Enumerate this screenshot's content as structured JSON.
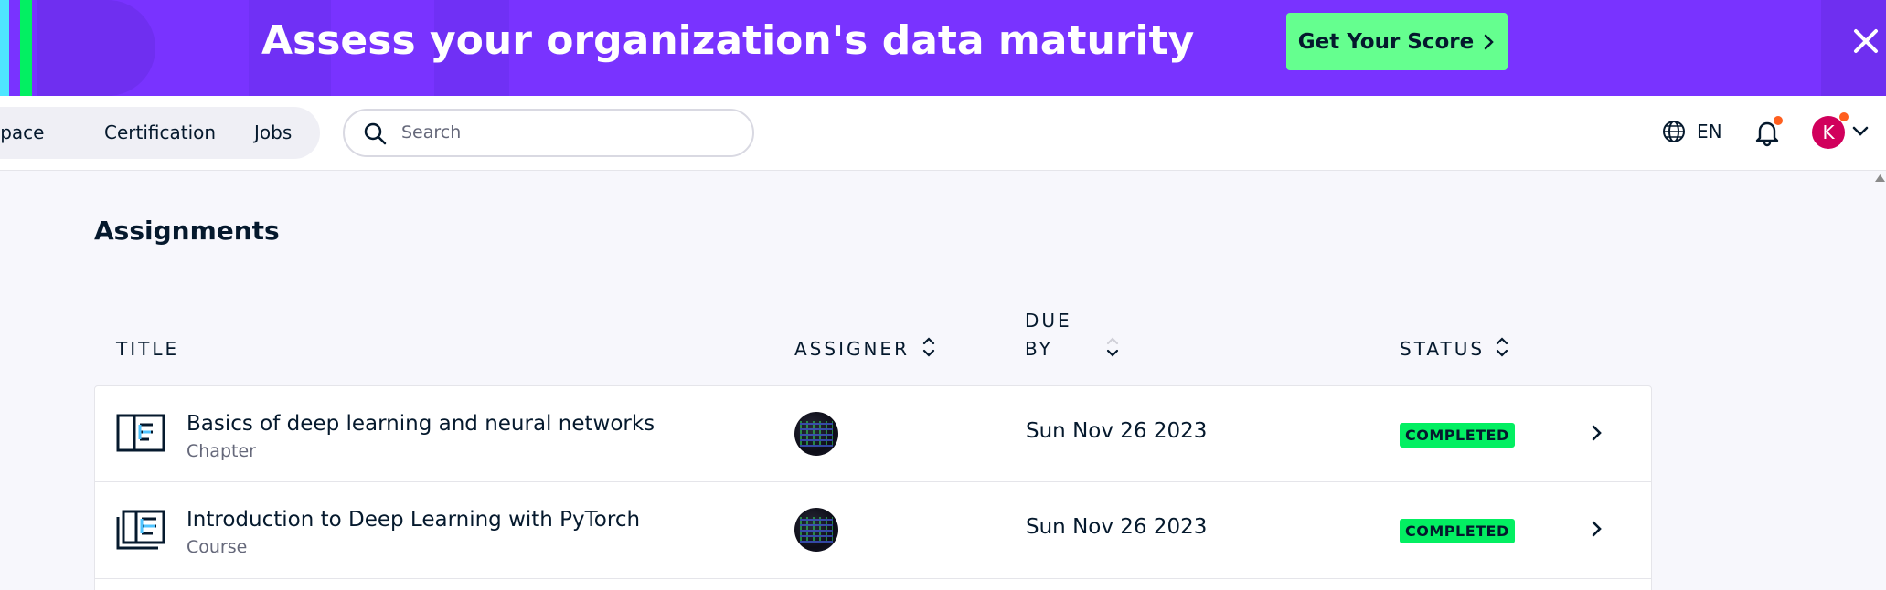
{
  "banner": {
    "title": "Assess your organization's data maturity",
    "cta_label": "Get Your Score",
    "colors": {
      "background": "#7933ff",
      "cta": "#65ff8f"
    }
  },
  "nav": {
    "items": [
      {
        "label": "rkspace"
      },
      {
        "label": "Certification"
      },
      {
        "label": "Jobs"
      }
    ],
    "search_placeholder": "Search",
    "language": "EN",
    "avatar_initial": "K"
  },
  "page": {
    "title": "Assignments"
  },
  "table": {
    "headers": {
      "title": "TITLE",
      "assigner": "ASSIGNER",
      "due_line1": "DUE",
      "due_line2": "BY",
      "status": "STATUS"
    },
    "rows": [
      {
        "title": "Basics of deep learning and neural networks",
        "type": "Chapter",
        "icon": "chapter-icon",
        "due": "Sun Nov 26 2023",
        "status": "COMPLETED"
      },
      {
        "title": "Introduction to Deep Learning with PyTorch",
        "type": "Course",
        "icon": "course-icon",
        "due": "Sun Nov 26 2023",
        "status": "COMPLETED"
      }
    ],
    "colors": {
      "status_completed": "#03ef62"
    }
  }
}
